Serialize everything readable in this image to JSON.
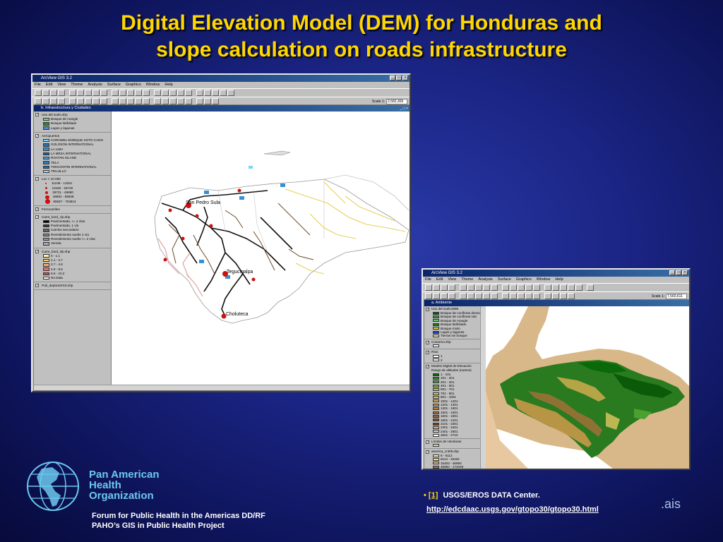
{
  "slide": {
    "title_line1": "Digital Elevation Model (DEM) for Honduras and",
    "title_line2": "slope calculation on roads infrastructure"
  },
  "window1": {
    "title": "ArcView GIS 3.2",
    "menu": [
      "File",
      "Edit",
      "View",
      "Theme",
      "Analysis",
      "Surface",
      "Graphics",
      "Window",
      "Help"
    ],
    "scale_label": "Scale 1:",
    "scale_value": "2,582,306",
    "view_title": "b. Infraestructura y Ciudades",
    "legend": [
      {
        "name": "Uso del suelo.shp",
        "items": [
          {
            "label": "Bosque de mangle",
            "color": "#8fd18f"
          },
          {
            "label": "Bosque latifoliado",
            "color": "#2c8a2c"
          },
          {
            "label": "Lagos y lagunas",
            "color": "#5a7fd6"
          }
        ]
      },
      {
        "name": "Aeropuertos",
        "items": [
          {
            "label": "COROMEL ENRIQUE SOTO CANO",
            "color": "#7ad6f0"
          },
          {
            "label": "GOLOSON INTERNATIONAL",
            "color": "#2b6fb0"
          },
          {
            "label": "LA LIMA",
            "color": "#3a8fd0"
          },
          {
            "label": "LA MESA INTERNATIONAL",
            "color": "#1d5fa0"
          },
          {
            "label": "ROATAN ISLAND",
            "color": "#4aa0e0"
          },
          {
            "label": "TELA",
            "color": "#2a80c8"
          },
          {
            "label": "TONCONTIN INTERNATIONAL",
            "color": "#1a70b8"
          },
          {
            "label": "TRUJILLO",
            "color": "#8ae0f8"
          }
        ]
      },
      {
        "name": "Loc < 10 000",
        "items": [
          {
            "label": "11248 - 13181",
            "color": "#cc1010"
          },
          {
            "label": "13182 - 26720",
            "color": "#cc1010"
          },
          {
            "label": "26721 - 46690",
            "color": "#cc1010"
          },
          {
            "label": "46691 - 85938",
            "color": "#cc1010"
          },
          {
            "label": "85937 - 704814",
            "color": "#cc1010"
          }
        ]
      },
      {
        "name": "Ferrocarriles",
        "items": []
      },
      {
        "name": "Carre_bord_clp.shp",
        "items": [
          {
            "label": "Pavimentada, >= 2 vías",
            "color": "#000000"
          },
          {
            "label": "Pavimentada, 1 vía",
            "color": "#333333"
          },
          {
            "label": "Camino secundario",
            "color": "#666666"
          },
          {
            "label": "Revestimiento suelto 1 vía",
            "color": "#888888"
          },
          {
            "label": "Revestimiento suelto >= 2 vías",
            "color": "#999999"
          },
          {
            "label": "Vereda",
            "color": "#aaaaaa"
          }
        ]
      },
      {
        "name": "Carre_bord_slp.shp",
        "items": [
          {
            "label": "0 - 1.1",
            "color": "#fff2b0"
          },
          {
            "label": "1.1 - 2.7",
            "color": "#f8d060"
          },
          {
            "label": "2.7 - 4.6",
            "color": "#f0a878"
          },
          {
            "label": "4.6 - 6.6",
            "color": "#e07878"
          },
          {
            "label": "6.6 - 10.2",
            "color": "#d05050"
          },
          {
            "label": "No Data",
            "color": "#ffffff"
          }
        ]
      },
      {
        "name": "Pob_deptosOrSS.shp",
        "items": []
      }
    ],
    "cities": [
      "San Pedro Sula",
      "Tegucigalpa",
      "Choluteca"
    ]
  },
  "window2": {
    "title": "ArcView GIS 3.2",
    "menu": [
      "File",
      "Edit",
      "View",
      "Theme",
      "Analysis",
      "Surface",
      "Graphics",
      "Window",
      "Help"
    ],
    "scale_label": "Scale 1:",
    "scale_value": "7,560,611",
    "view_title": "a. Ambiente",
    "legend": [
      {
        "name": "Uso del suelo1998",
        "items": [
          {
            "label": "Bosque de coníferas denso",
            "color": "#0a5a0a"
          },
          {
            "label": "Bosque de coníferas ralo",
            "color": "#3a9a3a"
          },
          {
            "label": "Bosque de mangle",
            "color": "#6ac06a"
          },
          {
            "label": "Bosque latifoliado",
            "color": "#1e7a1e"
          },
          {
            "label": "Bosque mixto",
            "color": "#d8d040"
          },
          {
            "label": "Lagos y lagunas",
            "color": "#2040c0"
          },
          {
            "label": "Tierras sin bosque",
            "color": "#f0e0a0"
          }
        ]
      },
      {
        "name": "Contorno.shp",
        "items": [
          {
            "label": "",
            "color": "#ffffff"
          }
        ]
      },
      {
        "name": "Ríos",
        "items": [
          {
            "label": "1",
            "color": "#ffffff"
          },
          {
            "label": "2",
            "color": "#ffffff"
          }
        ]
      },
      {
        "name": "Modelo Digital de Elevación",
        "sub": "Rango de altitudes (metros)",
        "items": [
          {
            "label": "1 - 101",
            "color": "#0a6a0a"
          },
          {
            "label": "101 - 201",
            "color": "#2a8a2a"
          },
          {
            "label": "201 - 401",
            "color": "#4aa030"
          },
          {
            "label": "401 - 601",
            "color": "#7ab838"
          },
          {
            "label": "601 - 701",
            "color": "#a8c848"
          },
          {
            "label": "701 - 801",
            "color": "#d0d060"
          },
          {
            "label": "801 - 1001",
            "color": "#e0c860"
          },
          {
            "label": "1001 - 1201",
            "color": "#d8b050"
          },
          {
            "label": "1201 - 1301",
            "color": "#c89848"
          },
          {
            "label": "1301 - 1501",
            "color": "#b88040"
          },
          {
            "label": "1501 - 1601",
            "color": "#a87038"
          },
          {
            "label": "1601 - 1801",
            "color": "#986030"
          },
          {
            "label": "1801 - 2101",
            "color": "#885028"
          },
          {
            "label": "2101 - 2301",
            "color": "#784020"
          },
          {
            "label": "2301 - 2401",
            "color": "#c8b8a8"
          },
          {
            "label": "2401 - 2601",
            "color": "#e0d8d0"
          },
          {
            "label": "2601 - 2710",
            "color": "#ffffff"
          }
        ]
      },
      {
        "name": "Límites de Honduras",
        "items": [
          {
            "label": "",
            "color": "#f0d8b0"
          }
        ]
      },
      {
        "name": "america_cntrl5.shp",
        "items": [
          {
            "label": "6 - 6112",
            "color": "#fff0c8"
          },
          {
            "label": "6113 - 15402",
            "color": "#f0d8a0"
          },
          {
            "label": "15403 - 46993",
            "color": "#d8b888"
          },
          {
            "label": "46994 - 172049",
            "color": "#a87858"
          },
          {
            "label": "172050 - 269635",
            "color": "#704030"
          }
        ]
      }
    ]
  },
  "footer": {
    "org_line1": "Pan American",
    "org_line2": "Health",
    "org_line3": "Organization",
    "forum_line1": "Forum for Public Health in the Americas DD/RF",
    "forum_line2": "PAHO’s GIS in Public Health Project",
    "bullet": "•",
    "ref": "[1]",
    "source": "USGS/EROS DATA Center.",
    "url": "http://edcdaac.usgs.gov/gtopo30/gtopo30.html",
    "ais": ".ais"
  },
  "colors": {
    "title": "#ffd700",
    "org": "#6cc8ef",
    "background": "#1b2585"
  }
}
